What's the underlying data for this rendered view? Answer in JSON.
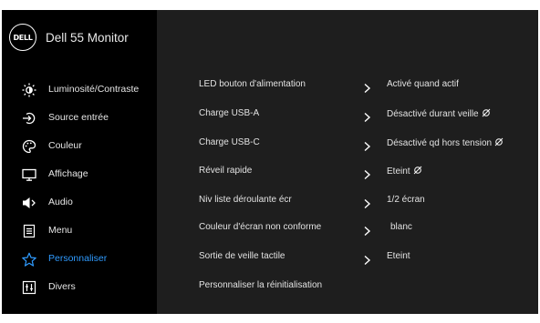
{
  "header": {
    "logo_text": "DELL",
    "model": "Dell 55 Monitor"
  },
  "sidebar": {
    "items": [
      {
        "label": "Luminosité/Contraste",
        "icon": "brightness-icon"
      },
      {
        "label": "Source entrée",
        "icon": "input-source-icon"
      },
      {
        "label": "Couleur",
        "icon": "color-palette-icon"
      },
      {
        "label": "Affichage",
        "icon": "display-icon"
      },
      {
        "label": "Audio",
        "icon": "speaker-icon"
      },
      {
        "label": "Menu",
        "icon": "menu-icon"
      },
      {
        "label": "Personnaliser",
        "icon": "star-icon",
        "active": true
      },
      {
        "label": "Divers",
        "icon": "others-icon"
      }
    ],
    "active_color": "#2f9bff"
  },
  "main": {
    "rows": [
      {
        "label": "LED bouton d'alimentation",
        "value": "Activé quand actif"
      },
      {
        "label": "Charge USB-A",
        "value": "Désactivé durant veille"
      },
      {
        "label": "Charge USB-C",
        "value": "Désactivé qd hors tension"
      },
      {
        "label": "Réveil rapide",
        "value": "Eteint"
      },
      {
        "label": "Niv liste déroulante écr",
        "value": "1/2 écran"
      },
      {
        "label": "Couleur d'écran non conforme",
        "value": "blanc"
      },
      {
        "label": "Sortie de veille tactile",
        "value": "Eteint"
      },
      {
        "label": "Personnaliser la réinitialisation"
      }
    ]
  }
}
